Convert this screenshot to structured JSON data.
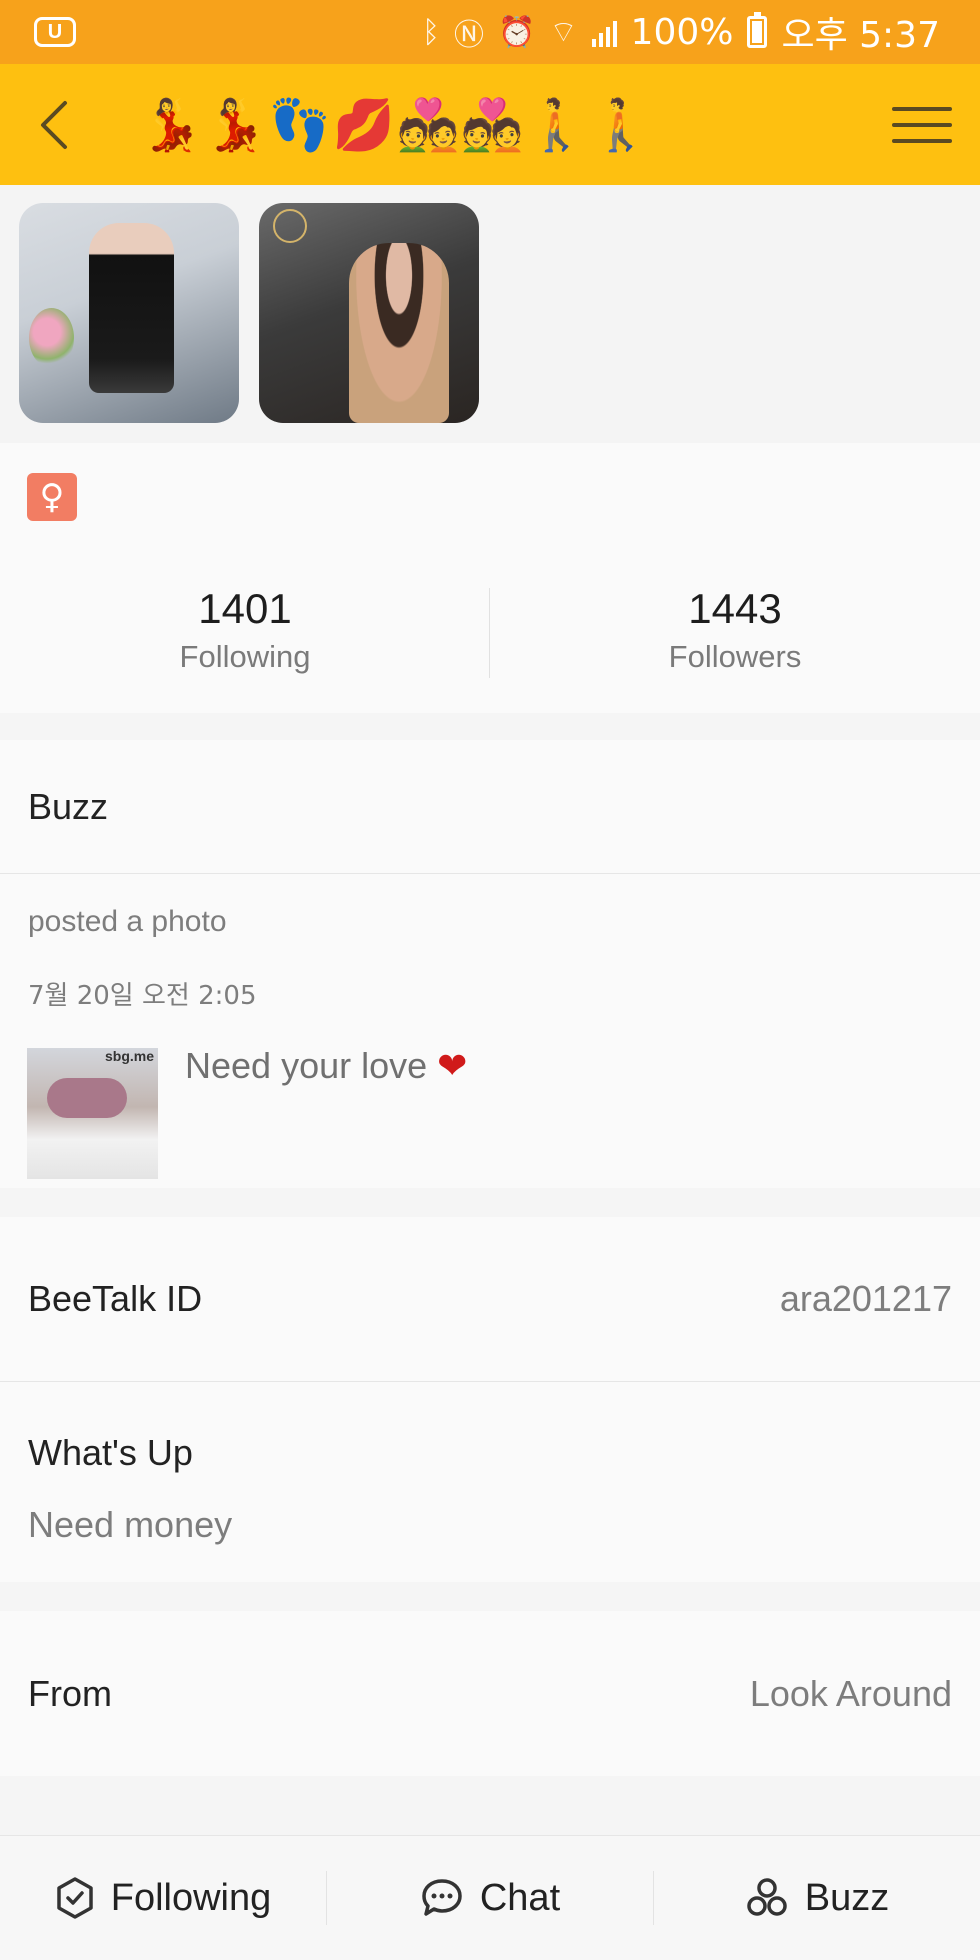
{
  "status_bar": {
    "battery": "100%",
    "time": "오후 5:37",
    "icons": [
      "app-badge-icon",
      "bluetooth-icon",
      "nfc-icon",
      "alarm-icon",
      "wifi-icon",
      "signal-icon",
      "battery-icon"
    ]
  },
  "header": {
    "title": "💃💃👣💋💑💑🚶🚶",
    "back_icon": "chevron-left-icon",
    "menu_icon": "hamburger-menu-icon"
  },
  "photos": [
    "profile-photo-1",
    "profile-photo-2"
  ],
  "profile": {
    "gender_symbol": "♀",
    "following_count": "1401",
    "following_label": "Following",
    "followers_count": "1443",
    "followers_label": "Followers"
  },
  "buzz": {
    "heading": "Buzz",
    "action": "posted a photo",
    "time": "7월 20일 오전 2:05",
    "text": "Need your love",
    "emoji": "❤",
    "watermark": "sbg.me"
  },
  "info": {
    "id_label": "BeeTalk ID",
    "id_value": "ara201217",
    "whatsup_label": "What's Up",
    "whatsup_value": "Need money",
    "from_label": "From",
    "from_value": "Look Around"
  },
  "bottom_bar": {
    "following": "Following",
    "chat": "Chat",
    "buzz": "Buzz"
  },
  "colors": {
    "status_bar": "#f7a21b",
    "header": "#fec010",
    "gender_badge": "#f27d63"
  }
}
